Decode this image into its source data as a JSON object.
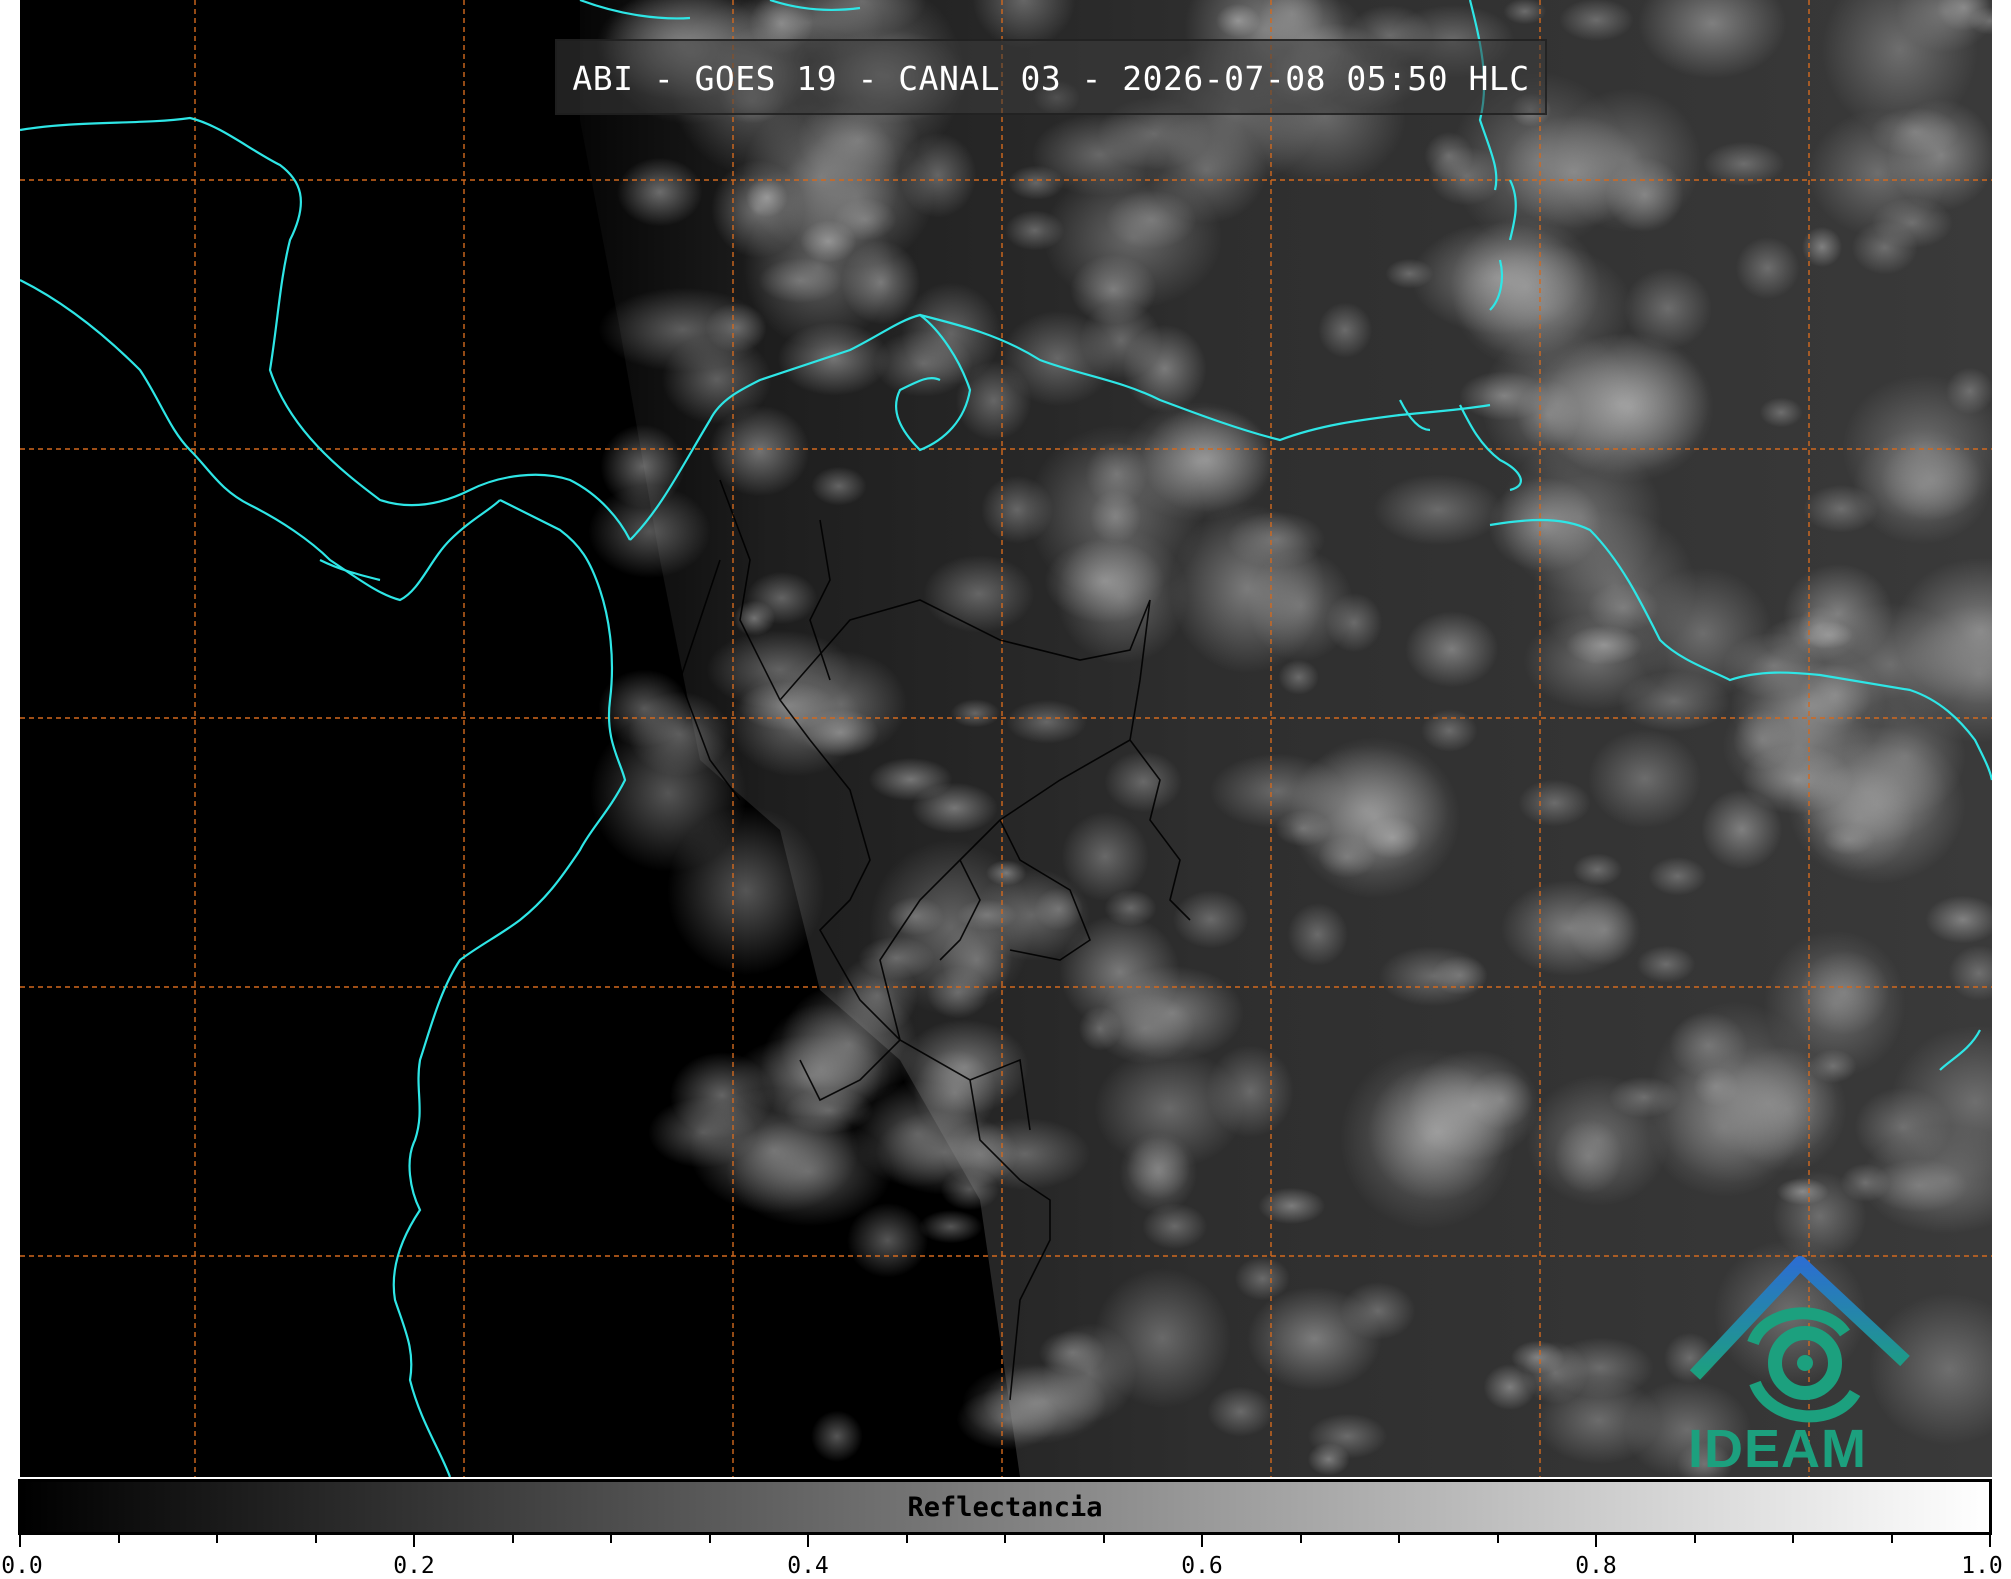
{
  "title": "ABI - GOES 19 - CANAL 03 - 2026-07-08 05:50 HLC",
  "colors": {
    "coastline": "#2ee6e6",
    "grid": "#d2691e",
    "borders": "#000000",
    "logo_blue": "#2b7bd0",
    "logo_green": "#1ca07e"
  },
  "colorbar": {
    "label": "Reflectancia",
    "range": [
      0.0,
      1.0
    ],
    "colormap": "greys (black to white)",
    "ticks": [
      "0.0",
      "0.2",
      "0.4",
      "0.6",
      "0.8",
      "1.0"
    ]
  },
  "logo": {
    "text": "IDEAM"
  }
}
